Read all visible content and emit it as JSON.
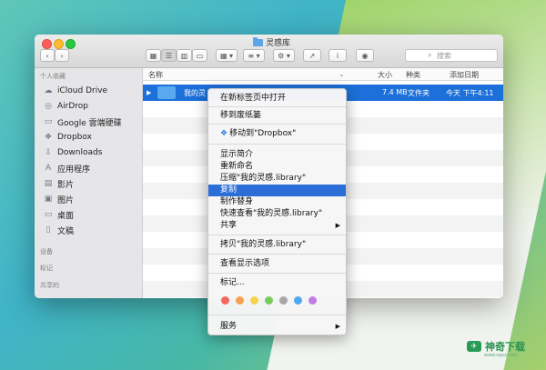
{
  "window": {
    "title": "灵感库",
    "search_placeholder": "搜索"
  },
  "toolbar": {
    "back": "‹",
    "forward": "›",
    "view_icon": "▦",
    "view_list": "☰",
    "view_columns": "▥",
    "view_cover": "▭",
    "arrange": "▦ ▾",
    "group": "≡ ▾",
    "action": "⚙ ▾",
    "share": "↗",
    "info": "i",
    "preview": "◉"
  },
  "sidebar": {
    "favorites_header": "个人收藏",
    "items": [
      {
        "label": "iCloud Drive",
        "icon": "☁"
      },
      {
        "label": "AirDrop",
        "icon": "◎"
      },
      {
        "label": "Google 雲端硬碟",
        "icon": "▭"
      },
      {
        "label": "Dropbox",
        "icon": "❖"
      },
      {
        "label": "Downloads",
        "icon": "⇩"
      },
      {
        "label": "应用程序",
        "icon": "A"
      },
      {
        "label": "影片",
        "icon": "▤"
      },
      {
        "label": "图片",
        "icon": "▣"
      },
      {
        "label": "桌面",
        "icon": "▭"
      },
      {
        "label": "文稿",
        "icon": "▯"
      }
    ],
    "devices_header": "设备",
    "tags_header": "标记",
    "shared_header": "共享的"
  },
  "columns": {
    "name": "名称",
    "size": "大小",
    "kind": "种类",
    "added": "添加日期"
  },
  "selected_row": {
    "expand": "▶",
    "name": "我的灵",
    "size": "7.4 MB",
    "kind": "文件夹",
    "date": "今天 下午4:11"
  },
  "context_menu": {
    "items": [
      "在新标签页中打开",
      "移到废纸篓",
      "移动到\"Dropbox\"",
      "显示简介",
      "重新命名",
      "压缩\"我的灵感.library\"",
      "复制",
      "制作替身",
      "快速查看\"我的灵感.library\"",
      "共享",
      "拷贝\"我的灵感.library\"",
      "查看显示选项",
      "标记...",
      "服务"
    ],
    "submenu_arrow": "▶",
    "tag_colors": [
      "#f2685c",
      "#f6a04d",
      "#f4d54a",
      "#76cc5b",
      "#a6a6a6",
      "#4fa8ee",
      "#c27de6"
    ]
  },
  "watermark": {
    "brand": "神奇下载",
    "mark": "✈",
    "sub": "www.sqxz.com"
  }
}
